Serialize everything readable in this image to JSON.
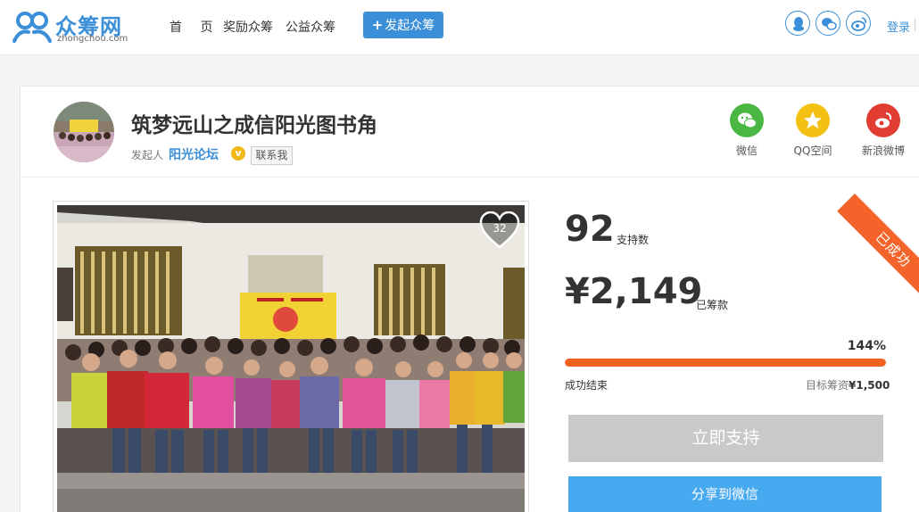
{
  "header": {
    "logo_text": "众筹网",
    "logo_sub": "zhongchou.com",
    "nav": {
      "home": "首 页",
      "reward": "奖励众筹",
      "charity": "公益众筹"
    },
    "launch_plus": "+",
    "launch_label": "发起众筹",
    "login": "登录",
    "social_icons": [
      "qq-icon",
      "wechat-icon",
      "weibo-icon"
    ]
  },
  "project": {
    "title": "筑梦远山之成信阳光图书角",
    "initiator_label": "发起人",
    "initiator_name": "阳光论坛",
    "verified_badge": "v",
    "contact_label": "联系我",
    "share": {
      "wechat": "微信",
      "qzone": "QQ空间",
      "weibo": "新浪微博"
    },
    "likes": "32",
    "status_ribbon": "已成功",
    "colors": {
      "accent_blue": "#3b8fd8",
      "progress_orange": "#f0611f",
      "share_blue": "#47a9ef"
    }
  },
  "stats": {
    "backers": "92",
    "backers_label": "支持数",
    "raised": "¥2,149",
    "raised_label": "已筹款",
    "percent": "144%",
    "progress_fraction": 1.0,
    "status": "成功结束",
    "goal_label": "目标筹资",
    "goal_value": "¥1,500"
  },
  "actions": {
    "support": "立即支持",
    "share_wechat": "分享到微信"
  }
}
